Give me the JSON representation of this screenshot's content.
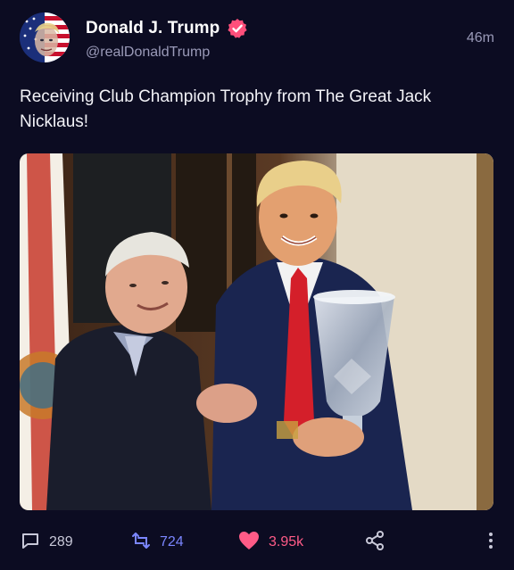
{
  "post": {
    "author": {
      "display_name": "Donald J. Trump",
      "handle": "@realDonaldTrump",
      "verified": true
    },
    "timestamp": "46m",
    "text": "Receiving Club Champion Trophy from The Great Jack Nicklaus!",
    "media": {
      "type": "photo"
    }
  },
  "actions": {
    "replies": "289",
    "reposts": "724",
    "likes": "3.95k"
  },
  "icons": {
    "reply": "comment-icon",
    "repost": "repost-icon",
    "like": "heart-icon",
    "share": "share-icon",
    "more": "more-vertical-icon",
    "verified": "verified-badge-icon"
  },
  "colors": {
    "background": "#0c0c22",
    "verified_badge": "#ff4f7b",
    "repost_accent": "#7b86ff",
    "like_accent": "#ff5b87",
    "muted_text": "#9a9ab8"
  }
}
